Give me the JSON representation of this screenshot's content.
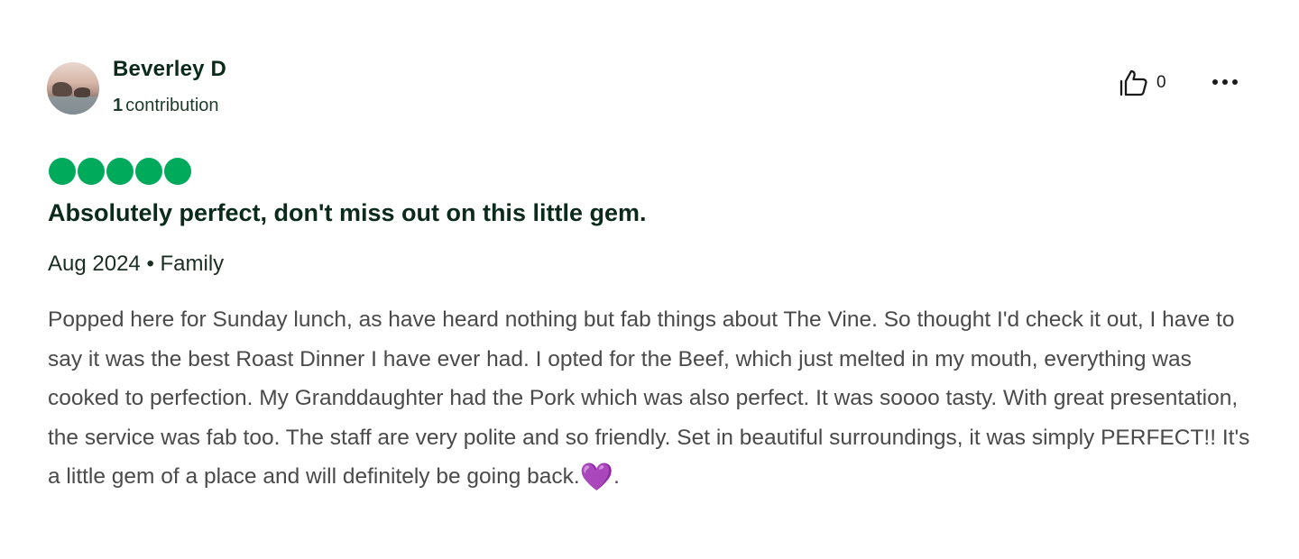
{
  "reviewer": {
    "name": "Beverley D",
    "contribution_count": "1",
    "contribution_label": "contribution"
  },
  "actions": {
    "helpful_count": "0",
    "helpful_icon": "thumbs-up-icon",
    "more_icon": "more-options-icon"
  },
  "review": {
    "rating": 5,
    "rating_max": 5,
    "rating_color": "#00aa5b",
    "title": "Absolutely perfect, don't miss out on this little gem.",
    "date": "Aug 2024",
    "separator": "•",
    "trip_type": "Family",
    "text": "Popped here for Sunday lunch, as have heard nothing but fab things about The Vine. So thought I'd check it out, I have to say it was the best Roast Dinner I have ever had. I opted for the Beef, which just melted in my mouth, everything was cooked to perfection. My Granddaughter had the Pork which was also perfect. It was soooo tasty. With great presentation, the service was fab too. The staff are very polite and so friendly. Set in beautiful surroundings, it was simply PERFECT!! It's a little gem of a place and will definitely be going back.",
    "emoji": "💜",
    "text_end": "."
  }
}
